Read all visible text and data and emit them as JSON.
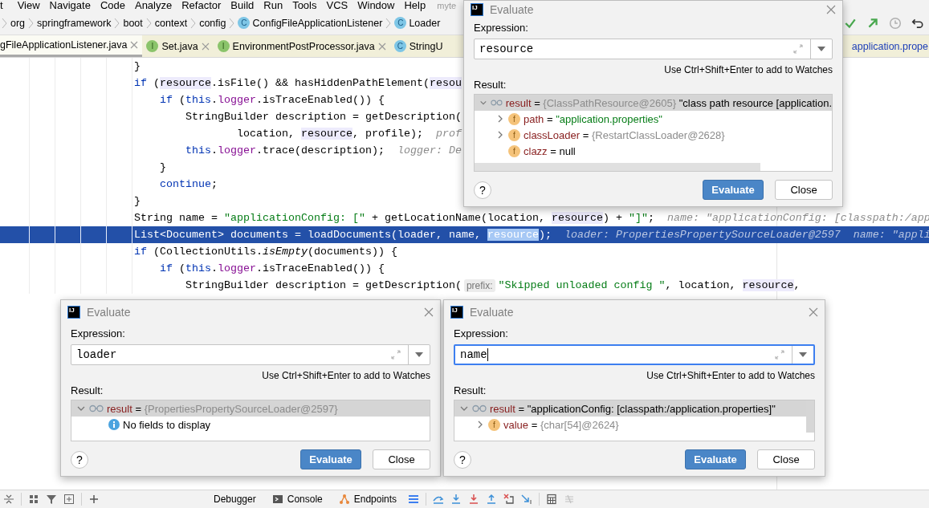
{
  "menu_bar": {
    "items": [
      "t",
      "View",
      "Navigate",
      "Code",
      "Analyze",
      "Refactor",
      "Build",
      "Run",
      "Tools",
      "VCS",
      "Window",
      "Help"
    ],
    "window_title": "myte"
  },
  "breadcrumbs": [
    {
      "label": "org",
      "kind": "package"
    },
    {
      "label": "springframework",
      "kind": "package"
    },
    {
      "label": "boot",
      "kind": "package"
    },
    {
      "label": "context",
      "kind": "package"
    },
    {
      "label": "config",
      "kind": "package"
    },
    {
      "label": "ConfigFileApplicationListener",
      "kind": "class",
      "icon_letter": "C"
    },
    {
      "label": "Loader",
      "kind": "class",
      "icon_letter": "C"
    }
  ],
  "editor_tabs": [
    {
      "label": "gFileApplicationListener.java",
      "kind": "plain",
      "selected": true,
      "closable": true
    },
    {
      "label": "Set.java",
      "kind": "interface",
      "icon_letter": "I",
      "selected": false,
      "closable": true
    },
    {
      "label": "EnvironmentPostProcessor.java",
      "kind": "interface",
      "icon_letter": "I",
      "selected": false,
      "closable": true
    },
    {
      "label": "StringU",
      "kind": "class",
      "icon_letter": "C",
      "selected": false,
      "closable": false
    }
  ],
  "editor_tabs_right": [
    {
      "label": "application.prope",
      "modified": true,
      "selected": false
    }
  ],
  "code_lines": [
    {
      "selected": false,
      "parts": [
        {
          "kind": "code",
          "tokens": [
            {
              "kind": "plain",
              "text": "}"
            }
          ]
        }
      ]
    },
    {
      "selected": false,
      "parts": [
        {
          "kind": "code",
          "tokens": [
            {
              "kind": "kw",
              "text": "if"
            },
            {
              "kind": "plain",
              "text": " ("
            },
            {
              "kind": "ref",
              "text": "resource"
            },
            {
              "kind": "plain",
              "text": ".isFile() && hasHiddenPathElement("
            },
            {
              "kind": "ref",
              "text": "resou"
            }
          ]
        }
      ]
    },
    {
      "selected": false,
      "parts": [
        {
          "kind": "code",
          "tokens": [
            {
              "kind": "kw",
              "text": "    if"
            },
            {
              "kind": "plain",
              "text": " ("
            },
            {
              "kind": "kw",
              "text": "this"
            },
            {
              "kind": "plain",
              "text": "."
            },
            {
              "kind": "field",
              "text": "logger"
            },
            {
              "kind": "plain",
              "text": ".isTraceEnabled()) {"
            }
          ]
        }
      ]
    },
    {
      "selected": false,
      "parts": [
        {
          "kind": "code",
          "tokens": [
            {
              "kind": "plain",
              "text": "        StringBuilder description = getDescription("
            }
          ]
        }
      ]
    },
    {
      "selected": false,
      "parts": [
        {
          "kind": "code",
          "tokens": [
            {
              "kind": "plain",
              "text": "                location, "
            },
            {
              "kind": "ref",
              "text": "resource"
            },
            {
              "kind": "plain",
              "text": ", profile);"
            }
          ]
        },
        {
          "kind": "hint",
          "text": "prof"
        }
      ]
    },
    {
      "selected": false,
      "parts": [
        {
          "kind": "code",
          "tokens": [
            {
              "kind": "kw",
              "text": "        this"
            },
            {
              "kind": "plain",
              "text": "."
            },
            {
              "kind": "field",
              "text": "logger"
            },
            {
              "kind": "plain",
              "text": ".trace(description);"
            }
          ]
        },
        {
          "kind": "hint",
          "text": "logger: De"
        }
      ]
    },
    {
      "selected": false,
      "parts": [
        {
          "kind": "code",
          "tokens": [
            {
              "kind": "plain",
              "text": "    }"
            }
          ]
        }
      ]
    },
    {
      "selected": false,
      "parts": [
        {
          "kind": "code",
          "tokens": [
            {
              "kind": "kw",
              "text": "    continue"
            },
            {
              "kind": "plain",
              "text": ";"
            }
          ]
        }
      ]
    },
    {
      "selected": false,
      "parts": [
        {
          "kind": "code",
          "tokens": [
            {
              "kind": "plain",
              "text": "}"
            }
          ]
        }
      ]
    },
    {
      "selected": false,
      "parts": [
        {
          "kind": "code",
          "tokens": [
            {
              "kind": "plain",
              "text": "String name = "
            },
            {
              "kind": "str",
              "text": "\"applicationConfig: [\""
            },
            {
              "kind": "plain",
              "text": " + getLocationName(location, "
            },
            {
              "kind": "ref",
              "text": "resource"
            },
            {
              "kind": "plain",
              "text": ") + "
            },
            {
              "kind": "str",
              "text": "\"]\""
            },
            {
              "kind": "plain",
              "text": ";"
            }
          ]
        },
        {
          "kind": "hint",
          "text": "name: \"applicationConfig: [classpath:/app"
        }
      ]
    },
    {
      "selected": true,
      "parts": [
        {
          "kind": "code",
          "tokens": [
            {
              "kind": "plain",
              "text": "List<Document> documents = loadDocuments(loader, name, "
            },
            {
              "kind": "sel",
              "text": "resource"
            },
            {
              "kind": "plain",
              "text": ");"
            }
          ]
        },
        {
          "kind": "hint",
          "text": "loader: PropertiesPropertySourceLoader@2597"
        },
        {
          "kind": "hint",
          "text": "name: \"appli"
        }
      ]
    },
    {
      "selected": false,
      "parts": [
        {
          "kind": "code",
          "tokens": [
            {
              "kind": "kw",
              "text": "if"
            },
            {
              "kind": "plain",
              "text": " (CollectionUtils."
            },
            {
              "kind": "italic",
              "text": "isEmpty"
            },
            {
              "kind": "plain",
              "text": "(documents)) {"
            }
          ]
        }
      ]
    },
    {
      "selected": false,
      "parts": [
        {
          "kind": "code",
          "tokens": [
            {
              "kind": "kw",
              "text": "    if"
            },
            {
              "kind": "plain",
              "text": " ("
            },
            {
              "kind": "kw",
              "text": "this"
            },
            {
              "kind": "plain",
              "text": "."
            },
            {
              "kind": "field",
              "text": "logger"
            },
            {
              "kind": "plain",
              "text": ".isTraceEnabled()) {"
            }
          ]
        }
      ]
    },
    {
      "selected": false,
      "parts": [
        {
          "kind": "code",
          "tokens": [
            {
              "kind": "plain",
              "text": "        StringBuilder description = getDescription("
            }
          ]
        },
        {
          "kind": "param",
          "text": "prefix:"
        },
        {
          "kind": "code",
          "tokens": [
            {
              "kind": "str",
              "text": "\"Skipped unloaded config \""
            },
            {
              "kind": "plain",
              "text": ", location, "
            },
            {
              "kind": "ref",
              "text": "resource"
            },
            {
              "kind": "plain",
              "text": ","
            }
          ]
        }
      ]
    }
  ],
  "dialogs": [
    {
      "logo_text": "IJ",
      "title": "Evaluate",
      "expression_label": "Expression:",
      "expression": "resource",
      "focused": false,
      "hint": "Use Ctrl+Shift+Enter to add to Watches",
      "result_label": "Result:",
      "help": "?",
      "evaluate_button": "Evaluate",
      "close_button": "Close",
      "tree": [
        {
          "kind": "watch",
          "name": "result",
          "eq": "=",
          "type": "{ClassPathResource@2605}",
          "value": {
            "kind": "plain",
            "text": "\"class path resource [application."
          },
          "has_children": true,
          "expanded": true,
          "selected": true,
          "children": [
            {
              "kind": "field",
              "badge": "f",
              "name": "path",
              "eq": "=",
              "value": {
                "kind": "string",
                "text": "\"application.properties\""
              },
              "has_children": true,
              "expanded": false,
              "selected": false
            },
            {
              "kind": "field",
              "badge": "f",
              "name": "classLoader",
              "eq": "=",
              "type": "{RestartClassLoader@2628}",
              "has_children": true,
              "expanded": false,
              "selected": false
            },
            {
              "kind": "field",
              "badge": "f",
              "name": "clazz",
              "eq": "=",
              "value": {
                "kind": "plain",
                "text": "null"
              },
              "has_children": false,
              "selected": false
            }
          ]
        }
      ]
    },
    {
      "logo_text": "IJ",
      "title": "Evaluate",
      "expression_label": "Expression:",
      "expression": "loader",
      "focused": false,
      "hint": "Use Ctrl+Shift+Enter to add to Watches",
      "result_label": "Result:",
      "help": "?",
      "evaluate_button": "Evaluate",
      "close_button": "Close",
      "tree": [
        {
          "kind": "watch",
          "name": "result",
          "eq": "=",
          "type": "{PropertiesPropertySourceLoader@2597}",
          "has_children": true,
          "expanded": true,
          "selected": true,
          "children": [
            {
              "kind": "info",
              "text": "No fields to display"
            }
          ]
        }
      ]
    },
    {
      "logo_text": "IJ",
      "title": "Evaluate",
      "expression_label": "Expression:",
      "expression": "name",
      "focused": true,
      "hint": "Use Ctrl+Shift+Enter to add to Watches",
      "result_label": "Result:",
      "help": "?",
      "evaluate_button": "Evaluate",
      "close_button": "Close",
      "tree": [
        {
          "kind": "watch",
          "name": "result",
          "eq": "=",
          "value": {
            "kind": "plain",
            "text": "\"applicationConfig: [classpath:/application.properties]\""
          },
          "has_children": true,
          "expanded": true,
          "selected": true,
          "children": [
            {
              "kind": "field",
              "badge": "f",
              "name": "value",
              "eq": "=",
              "type": "{char[54]@2624}",
              "has_children": true,
              "expanded": false,
              "selected": false
            }
          ]
        }
      ]
    }
  ],
  "tool_tabs": [
    {
      "label": "Debugger",
      "kind": "plain",
      "selected": false
    },
    {
      "label": "Console",
      "kind": "console",
      "selected": false
    },
    {
      "label": "Endpoints",
      "kind": "endpoints",
      "selected": false
    }
  ]
}
